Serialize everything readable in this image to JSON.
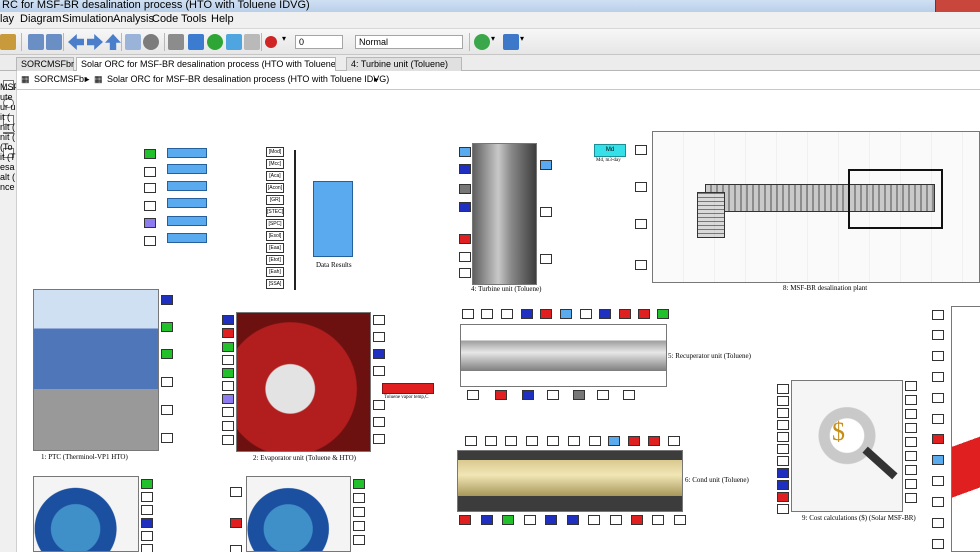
{
  "window": {
    "title": "RC for MSF-BR desalination process (HTO with Toluene IDVG)"
  },
  "menu": [
    "lay",
    "Diagram",
    "Simulation",
    "Analysis",
    "Code",
    "Tools",
    "Help"
  ],
  "toolbar": {
    "stop_time": "0",
    "sim_mode": "Normal"
  },
  "tabs": [
    {
      "label": "SORCMSFbr",
      "active": false
    },
    {
      "label": "Solar ORC for MSF-BR desalination process (HTO with Toluene IDVG)",
      "active": true
    },
    {
      "label": "4: Turbine unit (Toluene)",
      "active": false
    }
  ],
  "breadcrumb": {
    "root": "SORCMSFbr",
    "current": "Solar ORC for MSF-BR desalination process (HTO with Toluene IDVG)"
  },
  "left_clip": [
    "MSF",
    "ute",
    "ur u",
    "it (",
    "nit (",
    "nit (",
    "(To",
    "it (T",
    "esa",
    "alt (",
    "nce"
  ],
  "blocks": {
    "data_results": "Data Results",
    "turbine": "4: Turbine unit (Toluene)",
    "msf": "8: MSF-BR desalination plant",
    "ptc": "1: PTC (Therminol-VP1 HTO)",
    "evaporator": "2: Evaporator unit (Toluene & HTO)",
    "evap_out": "Toluene vapor temp,C",
    "recuperator": "5: Recuperator unit (Toluene)",
    "cond": "6: Cond unit (Toluene)",
    "cost": "9: Cost calculations ($) (Solar MSF-BR)",
    "md_day": "Md, m3-day",
    "md_box": "Md"
  },
  "data_results_inputs": [
    "[Mod]",
    "[Mcc]",
    "[Aca]",
    "[Acon]",
    "[GR]",
    "[STEC]",
    "[SPC]",
    "[Esol]",
    "[Eaa]",
    "[Etot]",
    "[Eah]",
    "[SSA]"
  ],
  "colors": {
    "bus": "#5aaaf0",
    "green": "#22c02a",
    "blue": "#1f2fbf",
    "red": "#e02020",
    "cyan": "#35e0e8"
  }
}
